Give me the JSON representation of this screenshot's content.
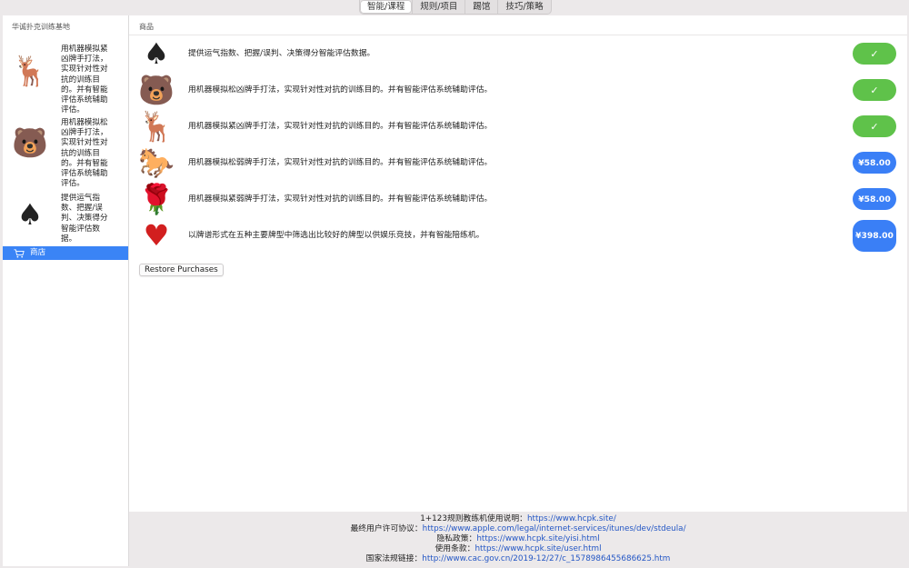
{
  "tabs": [
    {
      "label": "智能/课程",
      "active": true
    },
    {
      "label": "规则/项目",
      "active": false
    },
    {
      "label": "踢馆",
      "active": false
    },
    {
      "label": "技巧/策略",
      "active": false
    }
  ],
  "sidebar": {
    "title": "华诚扑克训练基地",
    "items": [
      {
        "icon": "deer-icon",
        "glyph": "🦌",
        "text": "用机器模拟紧凶牌手打法，实现针对性对抗的训练目的。并有智能评估系统辅助评估。"
      },
      {
        "icon": "bear-icon",
        "glyph": "🐻",
        "text": "用机器模拟松凶牌手打法，实现针对性对抗的训练目的。并有智能评估系统辅助评估。"
      },
      {
        "icon": "spade-icon",
        "glyph": "♠",
        "text": "提供运气指数、把握/误判、决策得分智能评估数据。"
      }
    ],
    "selected": {
      "icon": "cart-icon",
      "label": "商店"
    }
  },
  "store": {
    "header": "商品",
    "restore_label": "Restore Purchases",
    "products": [
      {
        "icon": "spade-icon",
        "glyph": "♠",
        "description": "提供运气指数、把握/误判、决策得分智能评估数据。",
        "status": "owned",
        "button": "✓"
      },
      {
        "icon": "bear-icon",
        "glyph": "🐻",
        "description": "用机器模拟松凶牌手打法，实现针对性对抗的训练目的。并有智能评估系统辅助评估。",
        "status": "owned",
        "button": "✓"
      },
      {
        "icon": "deer-icon",
        "glyph": "🦌",
        "description": "用机器模拟紧凶牌手打法，实现针对性对抗的训练目的。并有智能评估系统辅助评估。",
        "status": "owned",
        "button": "✓"
      },
      {
        "icon": "horse-icon",
        "glyph": "🐎",
        "description": "用机器模拟松弱牌手打法，实现针对性对抗的训练目的。并有智能评估系统辅助评估。",
        "status": "price",
        "button": "¥58.00"
      },
      {
        "icon": "rose-icon",
        "glyph": "🌹",
        "description": "用机器模拟紧弱牌手打法，实现针对性对抗的训练目的。并有智能评估系统辅助评估。",
        "status": "price",
        "button": "¥58.00"
      },
      {
        "icon": "heart-icon",
        "glyph": "♥",
        "description": "以牌谱形式在五种主要牌型中筛选出比较好的牌型以供娱乐竞技，并有智能陪练机。",
        "status": "price",
        "button": "¥398.00"
      }
    ]
  },
  "footer": {
    "lines": [
      {
        "label": "1+123规则教练机使用说明：",
        "link": "https://www.hcpk.site/"
      },
      {
        "label": "最终用户许可协议：",
        "link": "https://www.apple.com/legal/internet-services/itunes/dev/stdeula/"
      },
      {
        "label": "隐私政策：",
        "link": "https://www.hcpk.site/yisi.html"
      },
      {
        "label": "使用条款：",
        "link": "https://www.hcpk.site/user.html"
      },
      {
        "label": "国家法规链接：",
        "link": "http://www.cac.gov.cn/2019-12/27/c_1578986455686625.htm"
      }
    ]
  },
  "colors": {
    "owned_button": "#5fc24a",
    "price_button": "#3a7ff6",
    "selection": "#3a84f6",
    "link": "#2457c5"
  }
}
